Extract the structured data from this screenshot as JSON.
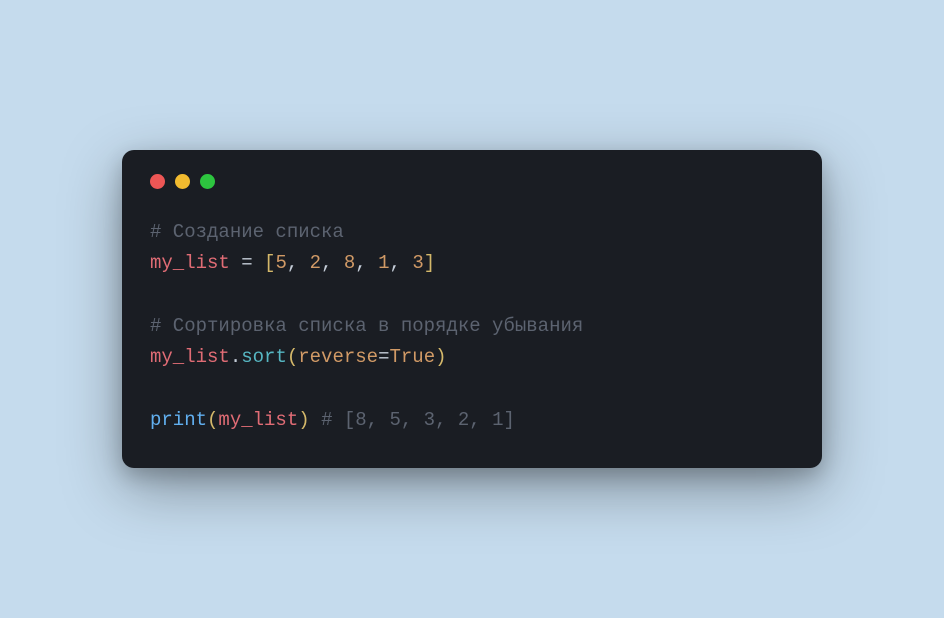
{
  "code": {
    "line1_comment": "# Создание списка",
    "line2_var": "my_list",
    "line2_eq": " = ",
    "line2_lb": "[",
    "line2_n1": "5",
    "line2_c1": ", ",
    "line2_n2": "2",
    "line2_c2": ", ",
    "line2_n3": "8",
    "line2_c3": ", ",
    "line2_n4": "1",
    "line2_c4": ", ",
    "line2_n5": "3",
    "line2_rb": "]",
    "line4_comment": "# Сортировка списка в порядке убывания",
    "line5_var": "my_list",
    "line5_dot": ".",
    "line5_method": "sort",
    "line5_lp": "(",
    "line5_param": "reverse",
    "line5_eq": "=",
    "line5_bool": "True",
    "line5_rp": ")",
    "line7_func": "print",
    "line7_lp": "(",
    "line7_var": "my_list",
    "line7_rp": ")",
    "line7_sp": " ",
    "line7_comment": "# [8, 5, 3, 2, 1]"
  }
}
